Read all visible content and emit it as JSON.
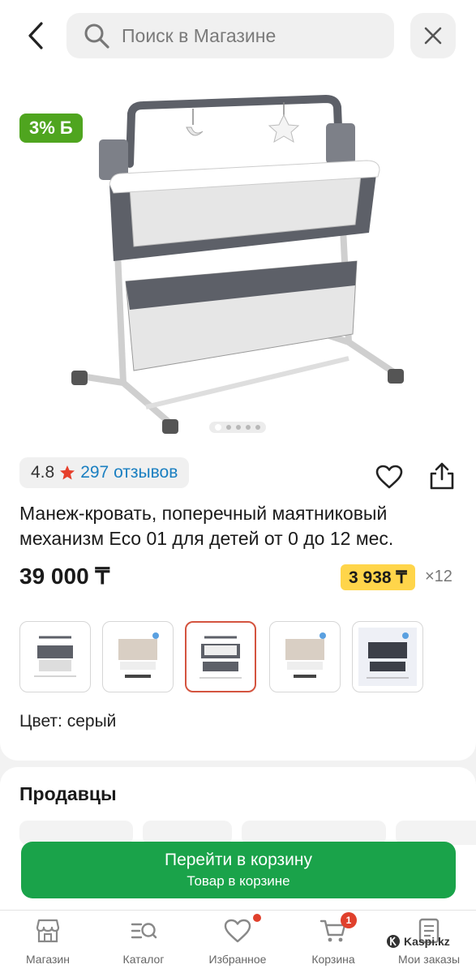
{
  "search": {
    "placeholder": "Поиск в Магазине"
  },
  "product": {
    "bonus_badge": "3% Б",
    "rating": "4.8",
    "reviews": "297 отзывов",
    "title": "Манеж-кровать, поперечный маятниковый механизм Eco 01 для детей от 0 до 12 мес.",
    "price": "39 000 ₸",
    "installment": "3 938 ₸",
    "installment_multiplier": "×12",
    "color": "Цвет: серый",
    "gallery": {
      "total_images": 5,
      "current_image": 1
    },
    "thumbnails_selected": 3
  },
  "sellers": {
    "title": "Продавцы"
  },
  "cart_button": {
    "label": "Перейти в корзину",
    "sublabel": "Товар в корзине"
  },
  "bottom_nav": {
    "items": [
      {
        "label": "Магазин",
        "icon": "shop-icon"
      },
      {
        "label": "Каталог",
        "icon": "catalog-icon"
      },
      {
        "label": "Избранное",
        "icon": "heart-icon"
      },
      {
        "label": "Корзина",
        "icon": "cart-icon",
        "badge": "1"
      },
      {
        "label": "Мои заказы",
        "icon": "orders-icon"
      }
    ]
  },
  "watermark": "Kaspi.kz",
  "colors": {
    "accent_green": "#1aa34a",
    "bonus_green": "#4fa51f",
    "installment_yellow": "#ffd54a",
    "link_blue": "#1a7fc1",
    "badge_red": "#e0402c"
  }
}
